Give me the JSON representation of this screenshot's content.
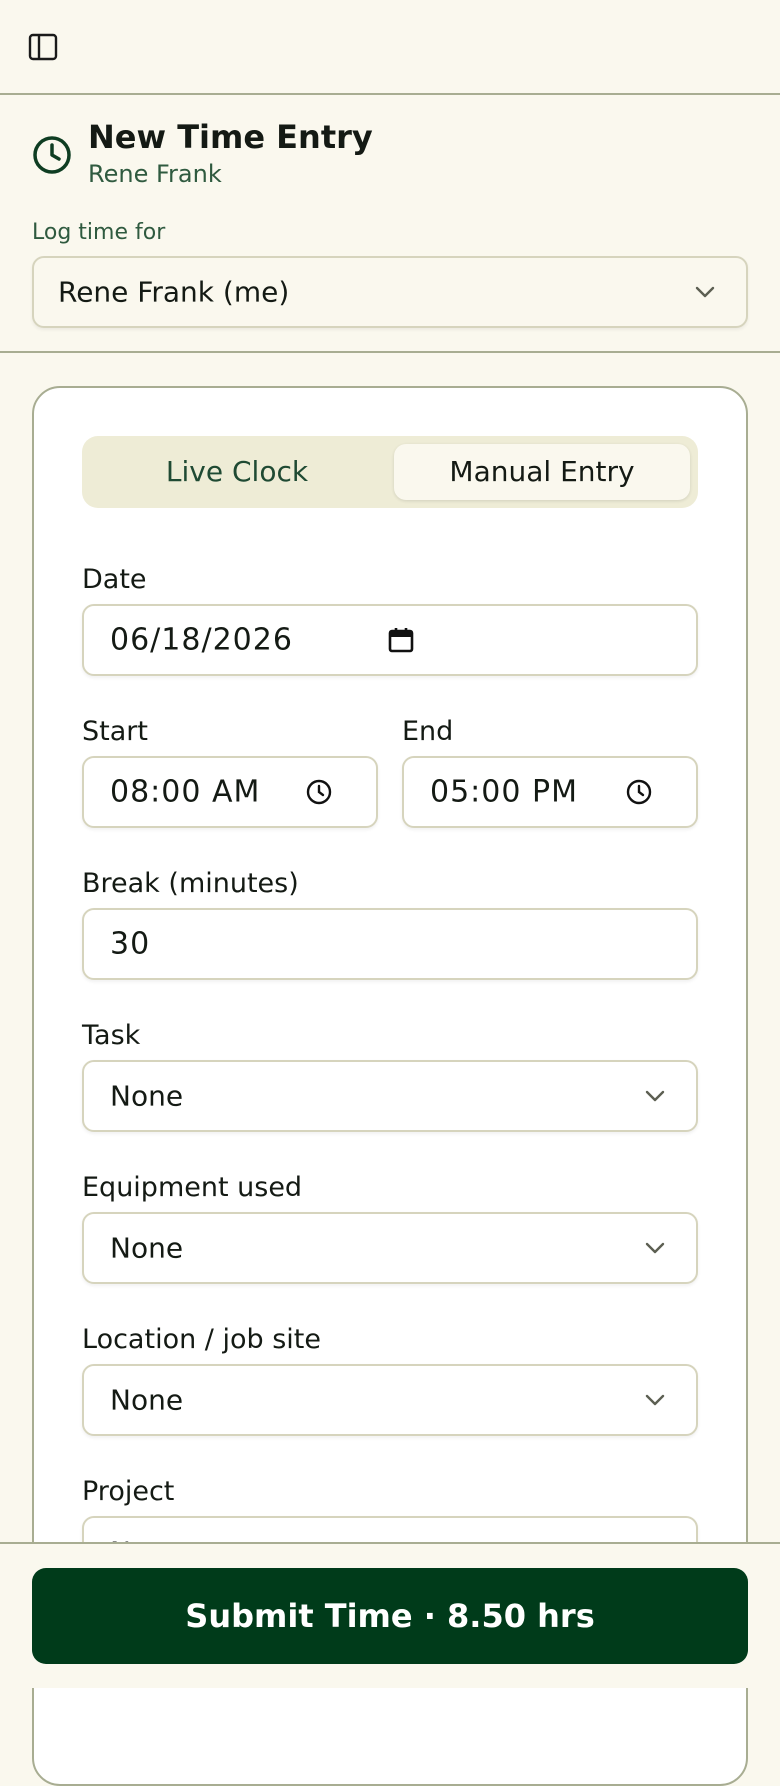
{
  "header": {
    "title": "New Time Entry",
    "subtitle": "Rene Frank",
    "log_time_for_label": "Log time for",
    "log_time_for_value": "Rene Frank (me)"
  },
  "mode_tabs": [
    {
      "label": "Live Clock",
      "selected": false
    },
    {
      "label": "Manual Entry",
      "selected": true
    }
  ],
  "form": {
    "date": {
      "label": "Date",
      "value": "06/18/2026"
    },
    "start": {
      "label": "Start",
      "value": "08:00 AM"
    },
    "end": {
      "label": "End",
      "value": "05:00 PM"
    },
    "break": {
      "label": "Break (minutes)",
      "value": "30"
    },
    "task": {
      "label": "Task",
      "value": "None"
    },
    "equipment": {
      "label": "Equipment used",
      "value": "None"
    },
    "location": {
      "label": "Location / job site",
      "value": "None"
    },
    "project": {
      "label": "Project",
      "value": "None"
    }
  },
  "submit_label": "Submit Time · 8.50 hrs",
  "icons": {
    "sidebar_toggle": "sidebar-toggle-icon",
    "header_clock": "clock-icon",
    "date_picker": "calendar-icon",
    "time_picker": "clock-icon",
    "dropdown": "chevron-down-icon"
  },
  "colors": {
    "background": "#faf8ee",
    "primary": "#003b1a",
    "accent_text": "#2f5a3f",
    "border": "#a8ad92",
    "segment_bg": "#eeecd6"
  }
}
